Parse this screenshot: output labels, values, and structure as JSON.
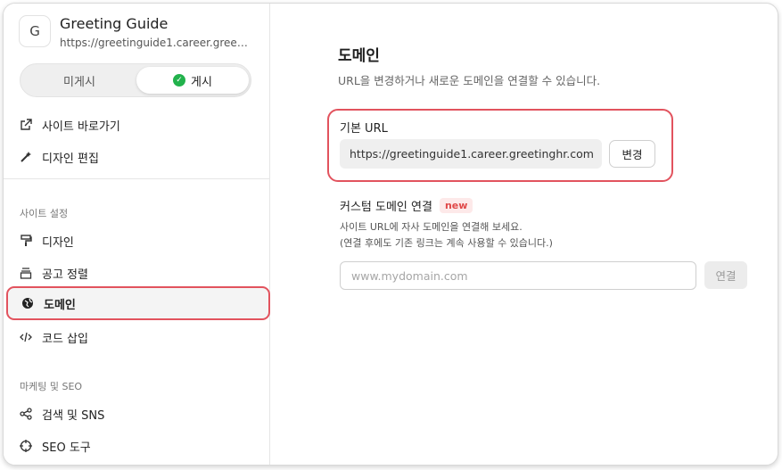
{
  "site": {
    "logo_letter": "G",
    "name": "Greeting Guide",
    "url": "https://greetinguide1.career.greeting..."
  },
  "publish_toggle": {
    "off_label": "미게시",
    "on_label": "게시",
    "selected": "게시"
  },
  "sidebar": {
    "top_items": [
      {
        "label": "사이트 바로가기",
        "icon": "external-link-icon"
      },
      {
        "label": "디자인 편집",
        "icon": "magic-wand-icon"
      }
    ],
    "site_settings_label": "사이트 설정",
    "site_settings_items": [
      {
        "label": "디자인",
        "icon": "paint-roller-icon"
      },
      {
        "label": "공고 정렬",
        "icon": "stack-icon"
      },
      {
        "label": "도메인",
        "icon": "globe-icon",
        "active": true
      },
      {
        "label": "코드 삽입",
        "icon": "code-icon"
      }
    ],
    "marketing_label": "마케팅 및 SEO",
    "marketing_items": [
      {
        "label": "검색 및 SNS",
        "icon": "share-icon"
      },
      {
        "label": "SEO 도구",
        "icon": "crosshair-icon"
      }
    ]
  },
  "main": {
    "title": "도메인",
    "subtitle": "URL을 변경하거나 새로운 도메인을 연결할 수 있습니다.",
    "base_url": {
      "label": "기본 URL",
      "value": "https://greetinguide1.career.greetinghr.com",
      "change_button": "변경"
    },
    "custom_domain": {
      "label": "커스텀 도메인 연결",
      "badge": "new",
      "help_line1": "사이트 URL에 자사 도메인을 연결해 보세요.",
      "help_line2": "(연결 후에도 기존 링크는 계속 사용할 수 있습니다.)",
      "placeholder": "www.mydomain.com",
      "connect_button": "연결"
    }
  },
  "colors": {
    "highlight_border": "#e2535e",
    "published_green": "#22b24c",
    "badge_red": "#e04848"
  }
}
